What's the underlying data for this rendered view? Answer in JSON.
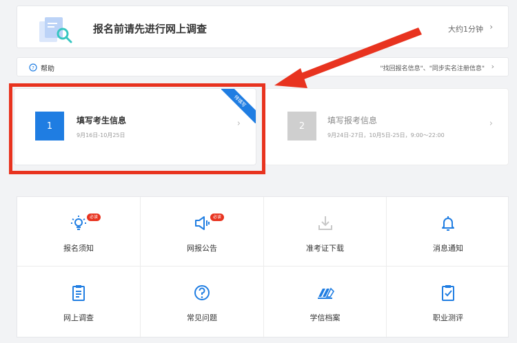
{
  "survey": {
    "title": "报名前请先进行网上调查",
    "time": "大约1分钟",
    "chevron": "›"
  },
  "help": {
    "label": "帮助",
    "links": "\"找回报名信息\"、\"同步实名注册信息\"",
    "chevron": "›"
  },
  "steps": [
    {
      "number": "1",
      "title": "填写考生信息",
      "date": "9月16日-10月25日",
      "ribbon": "待填写",
      "chevron": "›"
    },
    {
      "number": "2",
      "title": "填写报考信息",
      "date": "9月24日-27日，10月5日-25日，9:00～22:00",
      "chevron": "›"
    }
  ],
  "grid": [
    {
      "label": "报名须知",
      "icon": "bulb-icon",
      "badge": "必读"
    },
    {
      "label": "网报公告",
      "icon": "megaphone-icon",
      "badge": "必读"
    },
    {
      "label": "准考证下载",
      "icon": "download-icon"
    },
    {
      "label": "消息通知",
      "icon": "bell-icon"
    },
    {
      "label": "网上调查",
      "icon": "clipboard-icon"
    },
    {
      "label": "常见问题",
      "icon": "question-icon"
    },
    {
      "label": "学信档案",
      "icon": "archive-icon"
    },
    {
      "label": "职业测评",
      "icon": "checklist-icon"
    }
  ],
  "colors": {
    "accent": "#1f7de2",
    "highlight": "#e8331f",
    "disabled": "#cfcfcf"
  }
}
